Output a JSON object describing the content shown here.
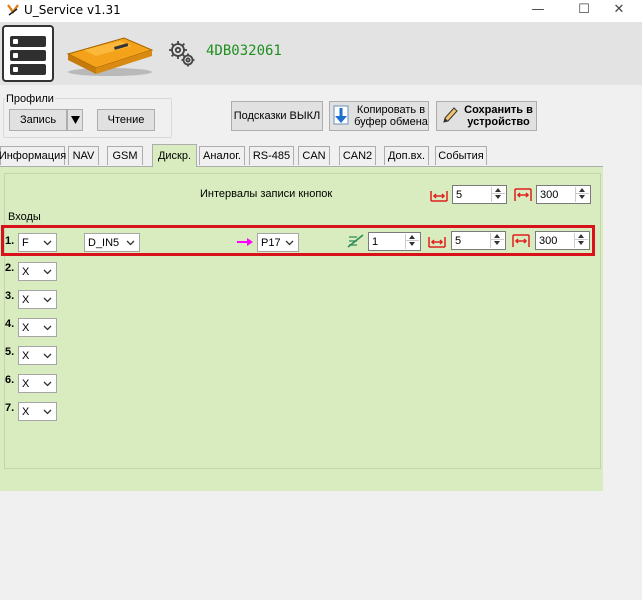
{
  "window": {
    "title": "U_Service v1.31",
    "controls": {
      "minimize": "—",
      "maximize": "☐",
      "close": "✕"
    }
  },
  "device": {
    "id": "4DB032061"
  },
  "profiles": {
    "label": "Профили",
    "record_button": "Запись",
    "read_button": "Чтение"
  },
  "toolbar": {
    "hints_button": "Подсказки ВЫКЛ",
    "copy_button": "Копировать в буфер обмена",
    "save_button": "Сохранить в устройство"
  },
  "tabs": [
    {
      "label": "Информация",
      "active": false
    },
    {
      "label": "NAV",
      "active": false
    },
    {
      "label": "GSM",
      "active": false
    },
    {
      "label": "Дискр.",
      "active": true
    },
    {
      "label": "Аналог.",
      "active": false
    },
    {
      "label": "RS-485",
      "active": false
    },
    {
      "label": "CAN",
      "active": false
    },
    {
      "label": "CAN2",
      "active": false
    },
    {
      "label": "Доп.вх.",
      "active": false
    },
    {
      "label": "События",
      "active": false
    }
  ],
  "discrete": {
    "button_intervals_label": "Интервалы записи кнопок",
    "button_interval_1": "5",
    "button_interval_2": "300",
    "inputs_label": "Входы",
    "rows": [
      {
        "num": "1.",
        "type": "F",
        "source": "D_IN5",
        "param": "P17",
        "filter": "1",
        "interval_1": "5",
        "interval_2": "300",
        "highlighted": true
      },
      {
        "num": "2.",
        "type": "X"
      },
      {
        "num": "3.",
        "type": "X"
      },
      {
        "num": "4.",
        "type": "X"
      },
      {
        "num": "5.",
        "type": "X"
      },
      {
        "num": "6.",
        "type": "X"
      },
      {
        "num": "7.",
        "type": "X"
      }
    ]
  },
  "colors": {
    "panel_bg": "#d8ecbf",
    "highlight": "#d9111b",
    "device_id": "#1f8f1f",
    "icon_red": "#e02020",
    "arrow_magenta": "#ff00ff"
  }
}
